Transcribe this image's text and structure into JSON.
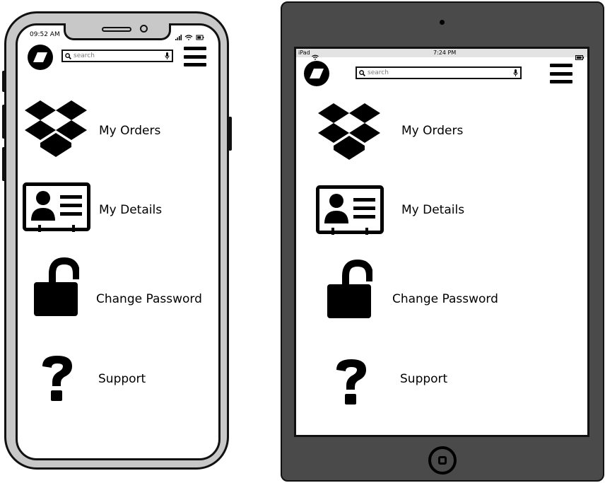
{
  "phone": {
    "status_time": "09:52 AM",
    "search_placeholder": "search",
    "menu": [
      {
        "label": "My Orders",
        "icon": "dropbox-icon"
      },
      {
        "label": "My Details",
        "icon": "id-card-icon"
      },
      {
        "label": "Change Password",
        "icon": "unlocked-padlock-icon"
      },
      {
        "label": "Support",
        "icon": "question-mark-icon"
      }
    ]
  },
  "tablet": {
    "status_device": "iPad",
    "status_time": "7:24 PM",
    "search_placeholder": "search",
    "menu": [
      {
        "label": "My Orders",
        "icon": "dropbox-icon"
      },
      {
        "label": "My Details",
        "icon": "id-card-icon"
      },
      {
        "label": "Change Password",
        "icon": "unlocked-padlock-icon"
      },
      {
        "label": "Support",
        "icon": "question-mark-icon"
      }
    ]
  },
  "colors": {
    "phone_frame": "#c8c8c8",
    "tablet_frame": "#4a4a4a",
    "tablet_statusbar": "#e3e3e3",
    "ink": "#000000"
  }
}
